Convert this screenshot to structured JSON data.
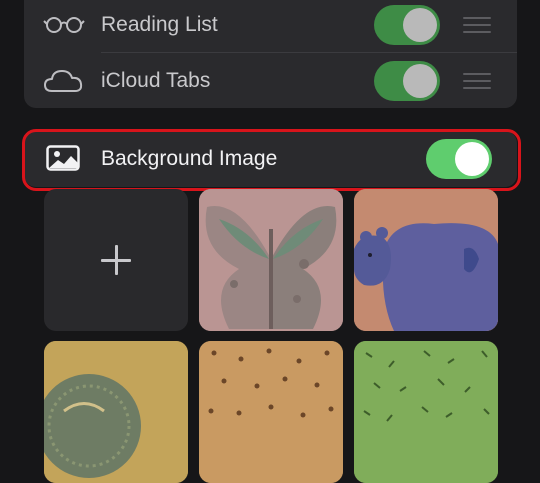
{
  "favorites_section": {
    "items": [
      {
        "label": "Reading List",
        "icon": "glasses-icon",
        "enabled": true
      },
      {
        "label": "iCloud Tabs",
        "icon": "cloud-icon",
        "enabled": true
      }
    ]
  },
  "background_image": {
    "label": "Background Image",
    "icon": "photo-icon",
    "enabled": true,
    "highlight_color": "#d8141b"
  },
  "image_grid": {
    "add_icon": "plus-icon",
    "tiles": [
      {
        "name": "add-image",
        "kind": "add"
      },
      {
        "name": "butterfly-wallpaper",
        "kind": "image"
      },
      {
        "name": "bear-wallpaper",
        "kind": "image"
      },
      {
        "name": "circle-pattern-wallpaper",
        "kind": "image"
      },
      {
        "name": "orange-speckle-wallpaper",
        "kind": "image"
      },
      {
        "name": "green-leaf-wallpaper",
        "kind": "image"
      }
    ]
  },
  "colors": {
    "background": "#161618",
    "panel": "#2a2a2d",
    "toggle_on": "#5fcd6e",
    "toggle_on_dim": "#3e8c46"
  }
}
